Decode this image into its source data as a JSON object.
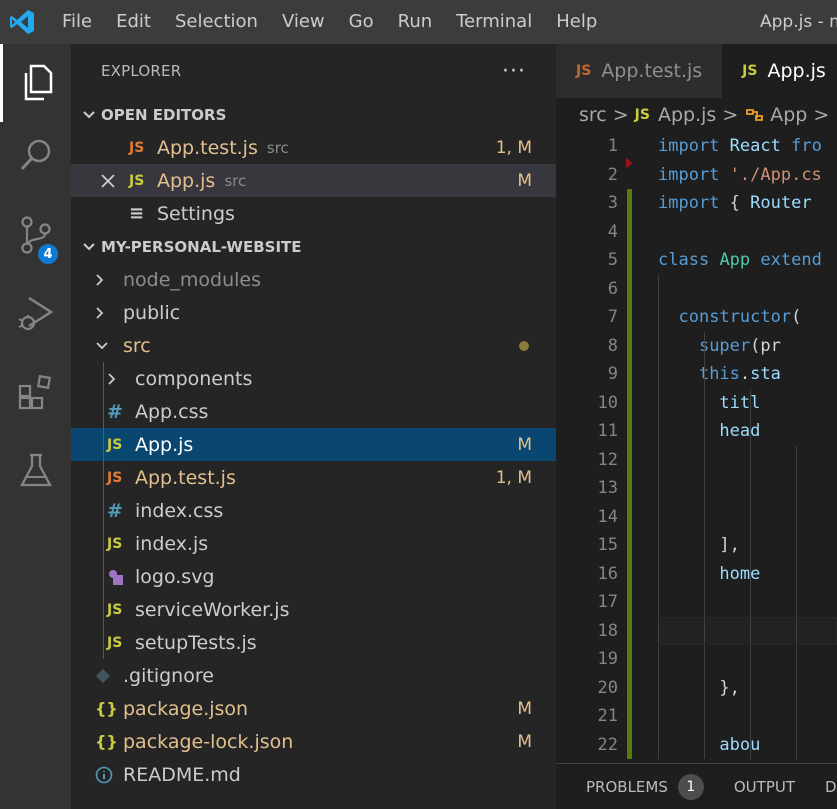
{
  "titlebar": {
    "menu": [
      "File",
      "Edit",
      "Selection",
      "View",
      "Go",
      "Run",
      "Terminal",
      "Help"
    ],
    "window_title": "App.js - m"
  },
  "activity": {
    "items": [
      "explorer-icon",
      "search-icon",
      "source-control-icon",
      "run-debug-icon",
      "extensions-icon",
      "testing-icon"
    ],
    "scm_badge": "4"
  },
  "sidebar": {
    "title": "EXPLORER",
    "more": "···",
    "open_editors": {
      "label": "OPEN EDITORS",
      "items": [
        {
          "icon": "JS",
          "name": "App.test.js",
          "desc": "src",
          "status": "1, M"
        },
        {
          "icon": "JS",
          "name": "App.js",
          "desc": "src",
          "status": "M"
        },
        {
          "icon": "≡",
          "name": "Settings",
          "desc": "",
          "status": ""
        }
      ]
    },
    "workspace": {
      "label": "MY-PERSONAL-WEBSITE",
      "tree": [
        {
          "icon": ">",
          "name": "node_modules",
          "status": ""
        },
        {
          "icon": ">",
          "name": "public",
          "status": ""
        },
        {
          "icon": "v",
          "name": "src",
          "status": ""
        },
        {
          "icon": ">",
          "name": "components",
          "status": ""
        },
        {
          "icon": "#",
          "name": "App.css",
          "status": ""
        },
        {
          "icon": "JS",
          "name": "App.js",
          "status": "M"
        },
        {
          "icon": "JS",
          "name": "App.test.js",
          "status": "1, M"
        },
        {
          "icon": "#",
          "name": "index.css",
          "status": ""
        },
        {
          "icon": "JS",
          "name": "index.js",
          "status": ""
        },
        {
          "icon": "svg",
          "name": "logo.svg",
          "status": ""
        },
        {
          "icon": "JS",
          "name": "serviceWorker.js",
          "status": ""
        },
        {
          "icon": "JS",
          "name": "setupTests.js",
          "status": ""
        },
        {
          "icon": "git",
          "name": ".gitignore",
          "status": ""
        },
        {
          "icon": "{}",
          "name": "package.json",
          "status": "M"
        },
        {
          "icon": "{}",
          "name": "package-lock.json",
          "status": "M"
        },
        {
          "icon": "i",
          "name": "README.md",
          "status": ""
        }
      ]
    }
  },
  "editor": {
    "tabs": [
      {
        "icon": "JS",
        "label": "App.test.js"
      },
      {
        "icon": "JS",
        "label": "App.js"
      }
    ],
    "breadcrumb": [
      "src",
      "App.js",
      "App"
    ],
    "lines": [
      {
        "n": "1",
        "code": [
          [
            "kw",
            "import"
          ],
          [
            "plain",
            " "
          ],
          [
            "var",
            "React"
          ],
          [
            "plain",
            " "
          ],
          [
            "kw",
            "fro"
          ]
        ]
      },
      {
        "n": "2",
        "code": [
          [
            "kw",
            "import"
          ],
          [
            "plain",
            " "
          ],
          [
            "str",
            "'./App.cs"
          ]
        ]
      },
      {
        "n": "3",
        "code": [
          [
            "kw",
            "import"
          ],
          [
            "plain",
            " { "
          ],
          [
            "var",
            "Router"
          ]
        ]
      },
      {
        "n": "4",
        "code": []
      },
      {
        "n": "5",
        "code": [
          [
            "kw",
            "class"
          ],
          [
            "plain",
            " "
          ],
          [
            "cls",
            "App"
          ],
          [
            "plain",
            " "
          ],
          [
            "kw",
            "extend"
          ]
        ]
      },
      {
        "n": "6",
        "code": []
      },
      {
        "n": "7",
        "code": [
          [
            "plain",
            "  "
          ],
          [
            "kw",
            "constructor"
          ],
          [
            "plain",
            "("
          ]
        ]
      },
      {
        "n": "8",
        "code": [
          [
            "plain",
            "    "
          ],
          [
            "kw",
            "super"
          ],
          [
            "plain",
            "(pr"
          ]
        ]
      },
      {
        "n": "9",
        "code": [
          [
            "plain",
            "    "
          ],
          [
            "kw",
            "this"
          ],
          [
            "plain",
            "."
          ],
          [
            "var",
            "sta"
          ]
        ]
      },
      {
        "n": "10",
        "code": [
          [
            "plain",
            "      "
          ],
          [
            "var",
            "titl"
          ]
        ]
      },
      {
        "n": "11",
        "code": [
          [
            "plain",
            "      "
          ],
          [
            "var",
            "head"
          ]
        ]
      },
      {
        "n": "12",
        "code": []
      },
      {
        "n": "13",
        "code": []
      },
      {
        "n": "14",
        "code": []
      },
      {
        "n": "15",
        "code": [
          [
            "plain",
            "      ],"
          ]
        ]
      },
      {
        "n": "16",
        "code": [
          [
            "plain",
            "      "
          ],
          [
            "var",
            "home"
          ]
        ]
      },
      {
        "n": "17",
        "code": []
      },
      {
        "n": "18",
        "code": []
      },
      {
        "n": "19",
        "code": []
      },
      {
        "n": "20",
        "code": [
          [
            "plain",
            "      },"
          ]
        ]
      },
      {
        "n": "21",
        "code": []
      },
      {
        "n": "22",
        "code": [
          [
            "plain",
            "      "
          ],
          [
            "var",
            "abou"
          ]
        ]
      }
    ]
  },
  "panel": {
    "problems_label": "PROBLEMS",
    "problems_count": "1",
    "output_label": "OUTPUT",
    "next_label": "D"
  },
  "colors": {
    "accent": "#0e7ad1",
    "selection": "#094771",
    "modified": "#e2c08d",
    "js_icon": "#cbcb41"
  }
}
